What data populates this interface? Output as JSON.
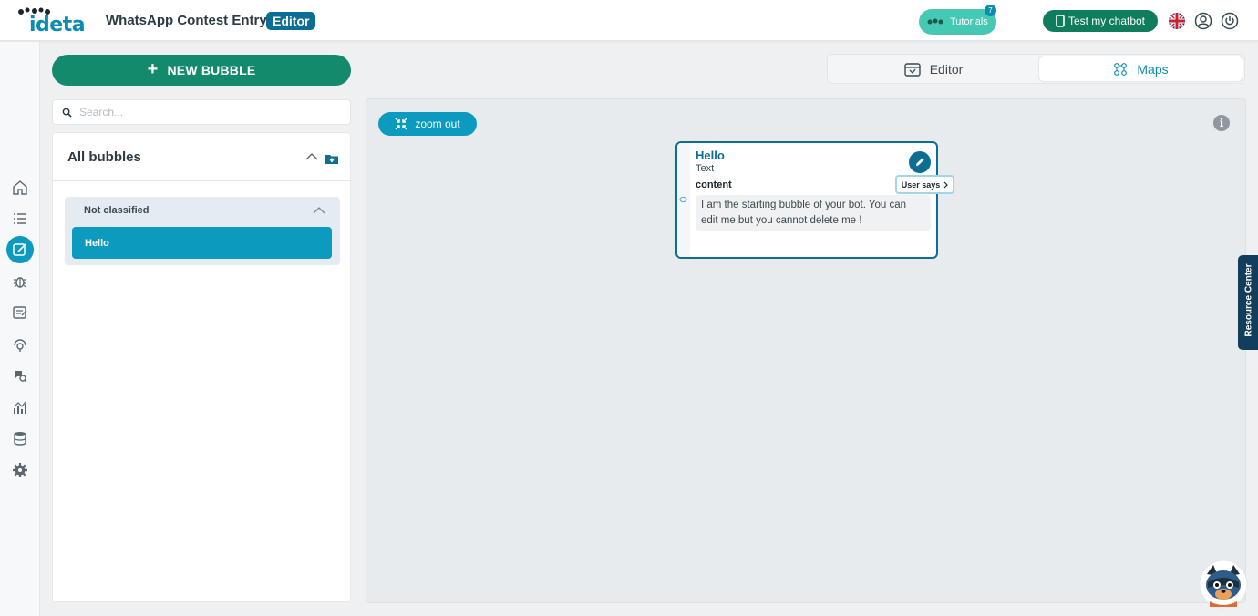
{
  "header": {
    "logo_text": "ideta",
    "title": "WhatsApp Contest Entry |",
    "mode_badge": "Editor",
    "tutorials_label": "Tutorials",
    "tutorials_count": "7",
    "test_chatbot_label": "Test my chatbot",
    "icons": [
      "uk-flag-icon",
      "user-account-icon",
      "power-icon"
    ]
  },
  "rail": {
    "items": [
      "home-icon",
      "list-icon",
      "editor-icon",
      "bug-icon",
      "forms-icon",
      "integrations-icon",
      "inbox-search-icon",
      "analytics-icon",
      "database-icon",
      "settings-icon"
    ],
    "active": "editor-icon"
  },
  "sidebar": {
    "new_bubble_label": "NEW BUBBLE",
    "search_placeholder": "Search...",
    "panel_title": "All bubbles",
    "groups": [
      {
        "title": "Not classified",
        "items": [
          {
            "label": "Hello",
            "selected": true
          }
        ]
      }
    ]
  },
  "tabs": [
    {
      "label": "Editor",
      "icon": "calendar-icon",
      "active": false
    },
    {
      "label": "Maps",
      "icon": "network-icon",
      "active": true
    }
  ],
  "canvas": {
    "zoom_out_label": "zoom out",
    "info_icon": "i",
    "bubble": {
      "title": "Hello",
      "type": "Text",
      "section_label": "content",
      "content": "I am the starting bubble of your bot. You can edit me but you cannot delete me !",
      "user_says_label": "User says"
    }
  },
  "resource_center_label": "Resource Center",
  "colors": {
    "primary": "#0c9bbf",
    "dark_blue": "#0d6e93",
    "green": "#148a6c",
    "teal": "#46c9b4",
    "navy": "#123e5c"
  }
}
